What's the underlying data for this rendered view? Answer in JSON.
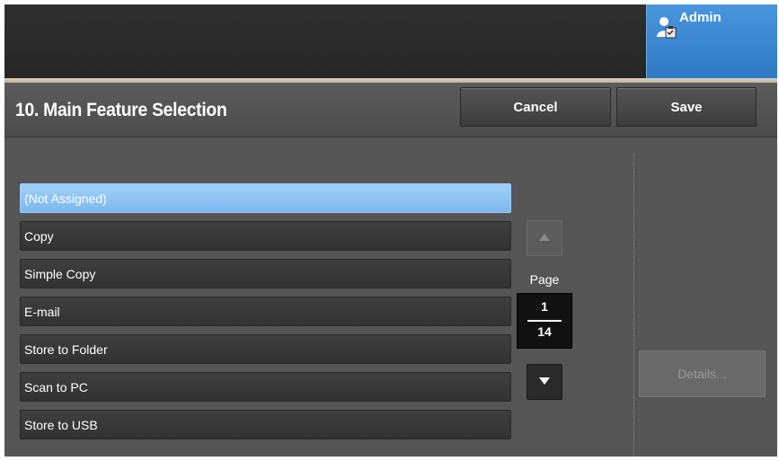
{
  "header": {
    "user_label": "Admin",
    "title": "10. Main Feature Selection",
    "cancel_label": "Cancel",
    "save_label": "Save"
  },
  "list": {
    "items": [
      {
        "label": "(Not Assigned)",
        "selected": true
      },
      {
        "label": "Copy",
        "selected": false
      },
      {
        "label": "Simple Copy",
        "selected": false
      },
      {
        "label": "E-mail",
        "selected": false
      },
      {
        "label": "Store to Folder",
        "selected": false
      },
      {
        "label": "Scan to PC",
        "selected": false
      },
      {
        "label": "Store to USB",
        "selected": false
      }
    ]
  },
  "pager": {
    "page_label": "Page",
    "current": "1",
    "total": "14",
    "up_icon": "triangle-up-icon",
    "down_icon": "triangle-down-icon"
  },
  "side": {
    "details_label": "Details..."
  },
  "colors": {
    "accent_blue": "#3b86d0",
    "selected_item": "#8cc4f4",
    "background": "#4d4d4d"
  }
}
